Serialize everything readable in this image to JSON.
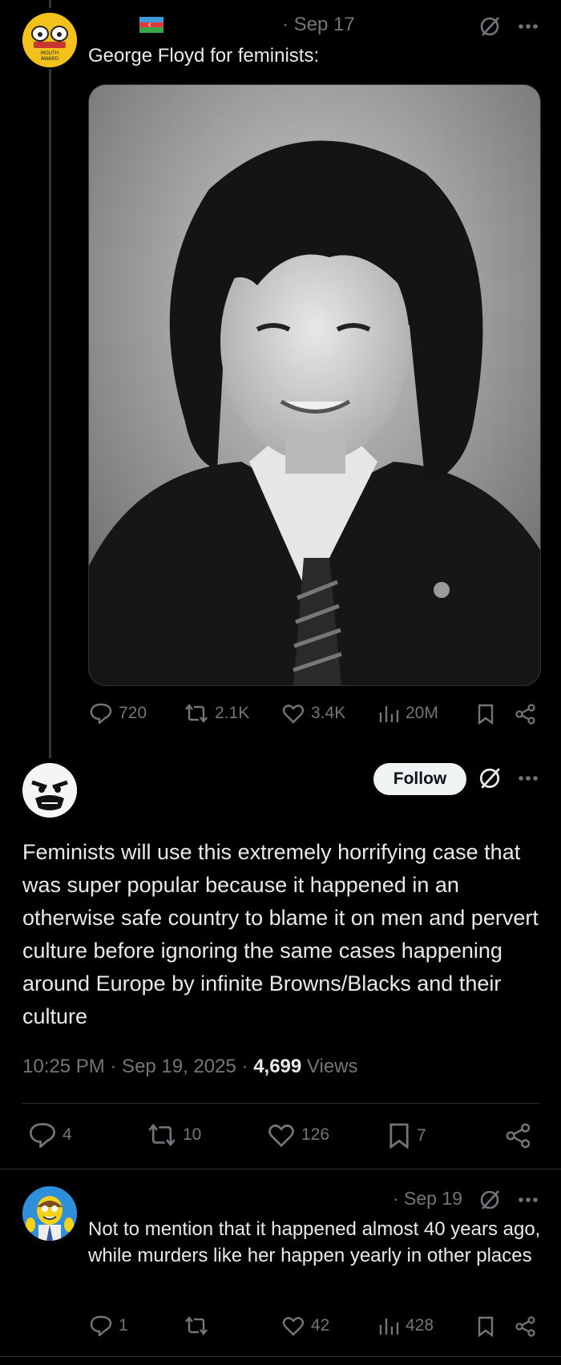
{
  "post1": {
    "date": "· Sep 17",
    "text": "George Floyd for feminists:",
    "flag": "azerbaijan-flag",
    "badge_text": [
      "MOUTH",
      "AWARD"
    ],
    "actions": {
      "replies": "720",
      "reposts": "2.1K",
      "likes": "3.4K",
      "views": "20M"
    }
  },
  "post2": {
    "follow_label": "Follow",
    "text": "Feminists will use this extremely horrifying case that was super popular because it happened in an otherwise safe country to blame it on men and pervert culture before ignoring the same cases happening around Europe by infinite Browns/Blacks and their culture",
    "time": "10:25 PM · Sep 19, 2025 ·",
    "views_count": "4,699",
    "views_label": "Views",
    "actions": {
      "replies": "4",
      "reposts": "10",
      "likes": "126",
      "bookmarks": "7"
    }
  },
  "post3": {
    "date": "· Sep 19",
    "text": "Not to mention that it happened almost 40 years ago, while murders like her happen yearly in other places",
    "actions": {
      "replies": "1",
      "reposts": "",
      "likes": "42",
      "views": "428"
    }
  },
  "colors": {
    "background": "#000000",
    "text": "#e7e9ea",
    "muted": "#71767b",
    "divider": "#2f3336",
    "follow_bg": "#eff3f4"
  }
}
